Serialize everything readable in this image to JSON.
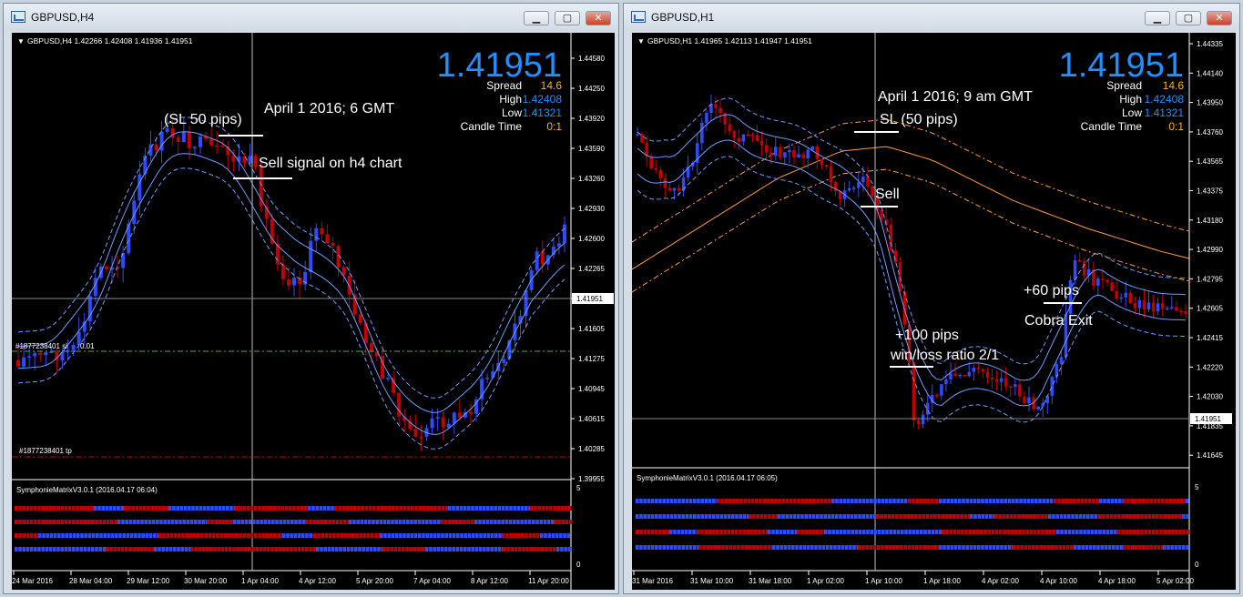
{
  "left": {
    "title": "GBPUSD,H4",
    "buttons": {
      "minimize": "▁",
      "maximize": "▢",
      "close": "✕"
    },
    "info": "GBPUSD,H4  1.42266 1.42408 1.41936 1.41951",
    "bid": "1.41951",
    "spread_label": "Spread",
    "spread": "14.6",
    "high_label": "High",
    "high": "1.42408",
    "low_label": "Low",
    "low": "1.41321",
    "candle_label": "Candle Time",
    "candle": "0:1",
    "annotations": {
      "sl": "(SL 50 pips)",
      "date": "April 1 2016; 6 GMT",
      "signal": "Sell signal on h4 chart"
    },
    "order_sl": "#1877238401 sl",
    "order_sl_value": "0.01",
    "order_tp": "#1877238401 tp",
    "price_ticks": [
      "1.44580",
      "1.44250",
      "1.43920",
      "1.43590",
      "1.43260",
      "1.42930",
      "1.42600",
      "1.42265",
      "1.41935",
      "1.41605",
      "1.41275",
      "1.40945",
      "1.40615",
      "1.40285",
      "1.39955"
    ],
    "current_price_tag": "1.41951",
    "indicator": "SymphonieMatrixV3.0.1 (2016.04.17 06:04)",
    "ind_scale": [
      "5",
      "0"
    ],
    "time_ticks": [
      "24 Mar 2016",
      "28 Mar 04:00",
      "29 Mar 12:00",
      "30 Mar 20:00",
      "1 Apr 04:00",
      "4 Apr 12:00",
      "5 Apr 20:00",
      "7 Apr 04:00",
      "8 Apr 12:00",
      "11 Apr 20:00"
    ]
  },
  "right": {
    "title": "GBPUSD,H1",
    "buttons": {
      "minimize": "▁",
      "maximize": "▢",
      "close": "✕"
    },
    "info": "GBPUSD,H1  1.41965 1.42113 1.41947 1.41951",
    "bid": "1.41951",
    "spread_label": "Spread",
    "spread": "14.6",
    "high_label": "High",
    "high": "1.42408",
    "low_label": "Low",
    "low": "1.41321",
    "candle_label": "Candle Time",
    "candle": "0:1",
    "annotations": {
      "date": "April 1 2016; 9 am GMT",
      "sl": "SL (50 pips)",
      "sell": "Sell",
      "pips100": "+100 pips",
      "ratio": "win/loss ratio 2/1",
      "pips60": "+60 pips",
      "exit": "Cobra Exit"
    },
    "price_ticks": [
      "1.44335",
      "1.44140",
      "1.43950",
      "1.43760",
      "1.43565",
      "1.43375",
      "1.43180",
      "1.42990",
      "1.42795",
      "1.42605",
      "1.42415",
      "1.42220",
      "1.42030",
      "1.41835",
      "1.41645"
    ],
    "current_price_tag": "1.41951",
    "indicator": "SymphonieMatrixV3.0.1 (2016.04.17 06:05)",
    "ind_scale": [
      "5",
      "0"
    ],
    "time_ticks": [
      "31 Mar 2016",
      "31 Mar 10:00",
      "31 Mar 18:00",
      "1 Apr 02:00",
      "1 Apr 10:00",
      "1 Apr 18:00",
      "4 Apr 02:00",
      "4 Apr 10:00",
      "4 Apr 18:00",
      "5 Apr 02:00"
    ]
  },
  "colors": {
    "bull": "#2f4bff",
    "bear": "#c40000",
    "bid": "#1e90ff",
    "band": "#6e9cff",
    "envelope": "#ff9a3c"
  }
}
